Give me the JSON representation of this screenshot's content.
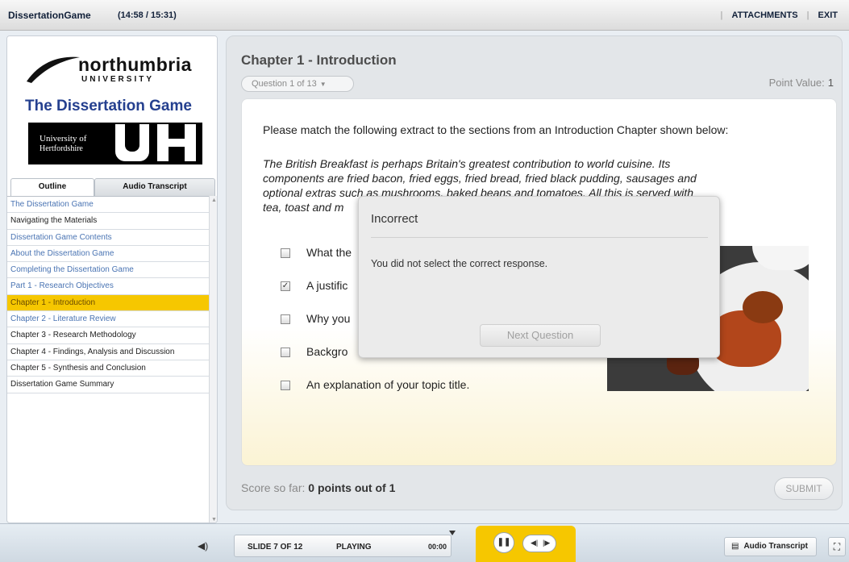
{
  "topbar": {
    "app_title": "DissertationGame",
    "time": "(14:58 / 15:31)",
    "attachments_label": "ATTACHMENTS",
    "separator": "|",
    "exit_label": "EXIT"
  },
  "sidebar": {
    "university_name": "northumbria",
    "university_sub": "UNIVERSITY",
    "game_title": "The Dissertation Game",
    "uh_line1": "University of",
    "uh_line2": "Hertfordshire",
    "tabs": [
      {
        "label": "Outline"
      },
      {
        "label": "Audio Transcript"
      }
    ],
    "outline_items": [
      {
        "label": "The Dissertation Game",
        "state": "visited"
      },
      {
        "label": "Navigating the Materials",
        "state": "normal"
      },
      {
        "label": "Dissertation Game Contents",
        "state": "visited"
      },
      {
        "label": "About the Dissertation Game",
        "state": "visited"
      },
      {
        "label": "Completing the Dissertation Game",
        "state": "visited"
      },
      {
        "label": "Part 1 - Research Objectives",
        "state": "visited"
      },
      {
        "label": "Chapter 1 - Introduction",
        "state": "current"
      },
      {
        "label": "Chapter 2 - Literature Review",
        "state": "visited"
      },
      {
        "label": "Chapter 3 - Research Methodology",
        "state": "normal"
      },
      {
        "label": "Chapter 4 - Findings, Analysis and Discussion",
        "state": "normal"
      },
      {
        "label": "Chapter 5 - Synthesis and Conclusion",
        "state": "normal"
      },
      {
        "label": "Dissertation Game Summary",
        "state": "normal"
      }
    ]
  },
  "main": {
    "chapter_title": "Chapter 1 - Introduction",
    "question_selector": "Question 1 of 13",
    "point_value_label": "Point Value:",
    "point_value": "1",
    "instruction": "Please match the following extract to the sections from an Introduction Chapter shown below:",
    "extract_lines": [
      "The British Breakfast is perhaps Britain's greatest contribution to world cuisine. Its",
      "components are fried bacon, fried eggs, fried bread, fried black pudding, sausages and",
      "optional extras such as mushrooms, baked beans and tomatoes. All this is served with",
      "tea, toast and m"
    ],
    "answers": [
      {
        "label": "What the",
        "checked": false
      },
      {
        "label": "A justific",
        "checked": true
      },
      {
        "label": "Why you",
        "checked": false
      },
      {
        "label": "Backgro",
        "checked": false
      },
      {
        "label": "An explanation of your topic title.",
        "checked": false
      }
    ],
    "score_label": "Score so far:",
    "score_value": "0 points out of 1",
    "submit_label": "SUBMIT"
  },
  "dialog": {
    "title": "Incorrect",
    "message": "You did not select the correct response.",
    "next_button": "Next Question"
  },
  "player": {
    "slide_counter": "SLIDE 7 OF 12",
    "state": "PLAYING",
    "time": "00:00",
    "audio_transcript_label": "Audio Transcript"
  },
  "colors": {
    "accent_yellow": "#f6c700",
    "brand_blue": "#25408f",
    "visited_link": "#4a74b3"
  }
}
